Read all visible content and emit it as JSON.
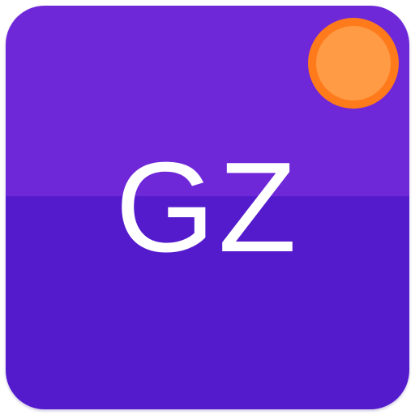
{
  "icon": {
    "monogram": "GZ",
    "colors": {
      "top": "#6f28d8",
      "bottom": "#541bcc",
      "text": "#ffffff",
      "badge_ring": "#ff7a1a",
      "badge_core": "#ff9a45"
    }
  },
  "notification_badge": {
    "visible": true
  }
}
